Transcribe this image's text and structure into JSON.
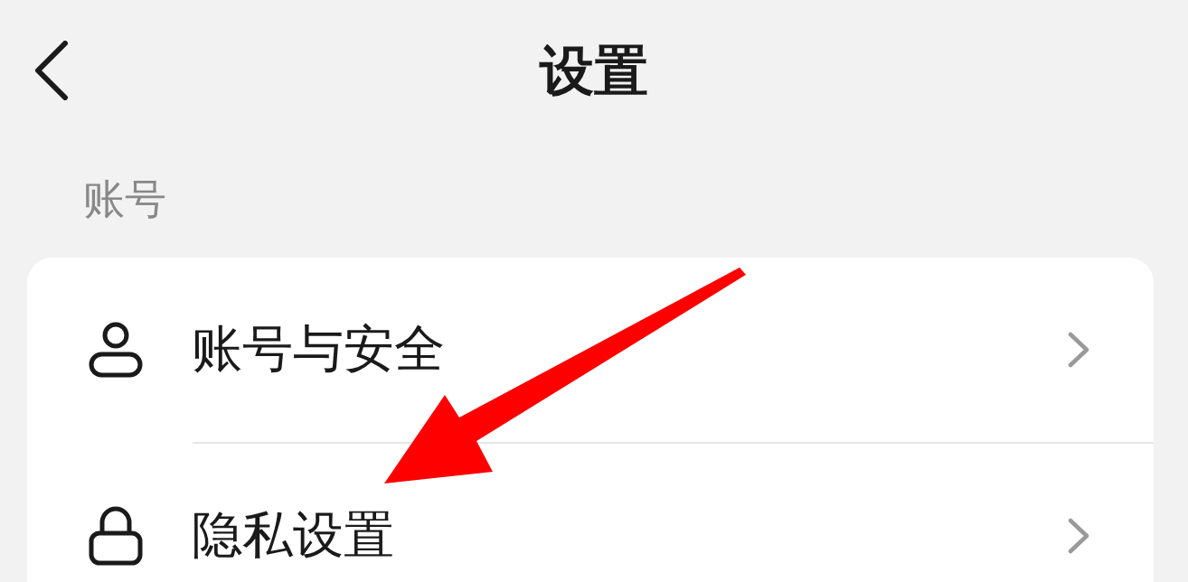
{
  "header": {
    "title": "设置"
  },
  "sections": [
    {
      "label": "账号",
      "items": [
        {
          "label": "账号与安全",
          "kind": "account"
        },
        {
          "label": "隐私设置",
          "kind": "privacy"
        }
      ]
    }
  ],
  "annotations": [
    {
      "kind": "arrow"
    }
  ]
}
